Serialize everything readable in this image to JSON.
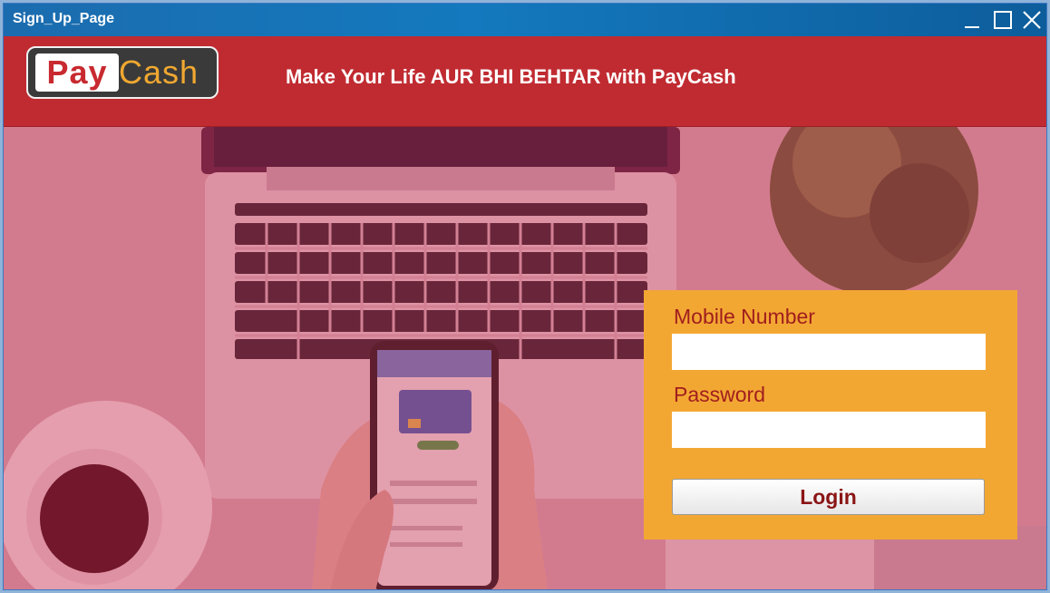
{
  "window": {
    "title": "Sign_Up_Page"
  },
  "header": {
    "logo_left": "Pay",
    "logo_right": "Cash",
    "tagline": "Make Your Life AUR BHI BEHTAR with PayCash"
  },
  "login": {
    "mobile_label": "Mobile Number",
    "mobile_value": "",
    "password_label": "Password",
    "password_value": "",
    "login_label": "Login"
  },
  "colors": {
    "titlebar": "#1479be",
    "header": "#c02b31",
    "panel": "#f3a733",
    "label": "#a01e1e"
  }
}
